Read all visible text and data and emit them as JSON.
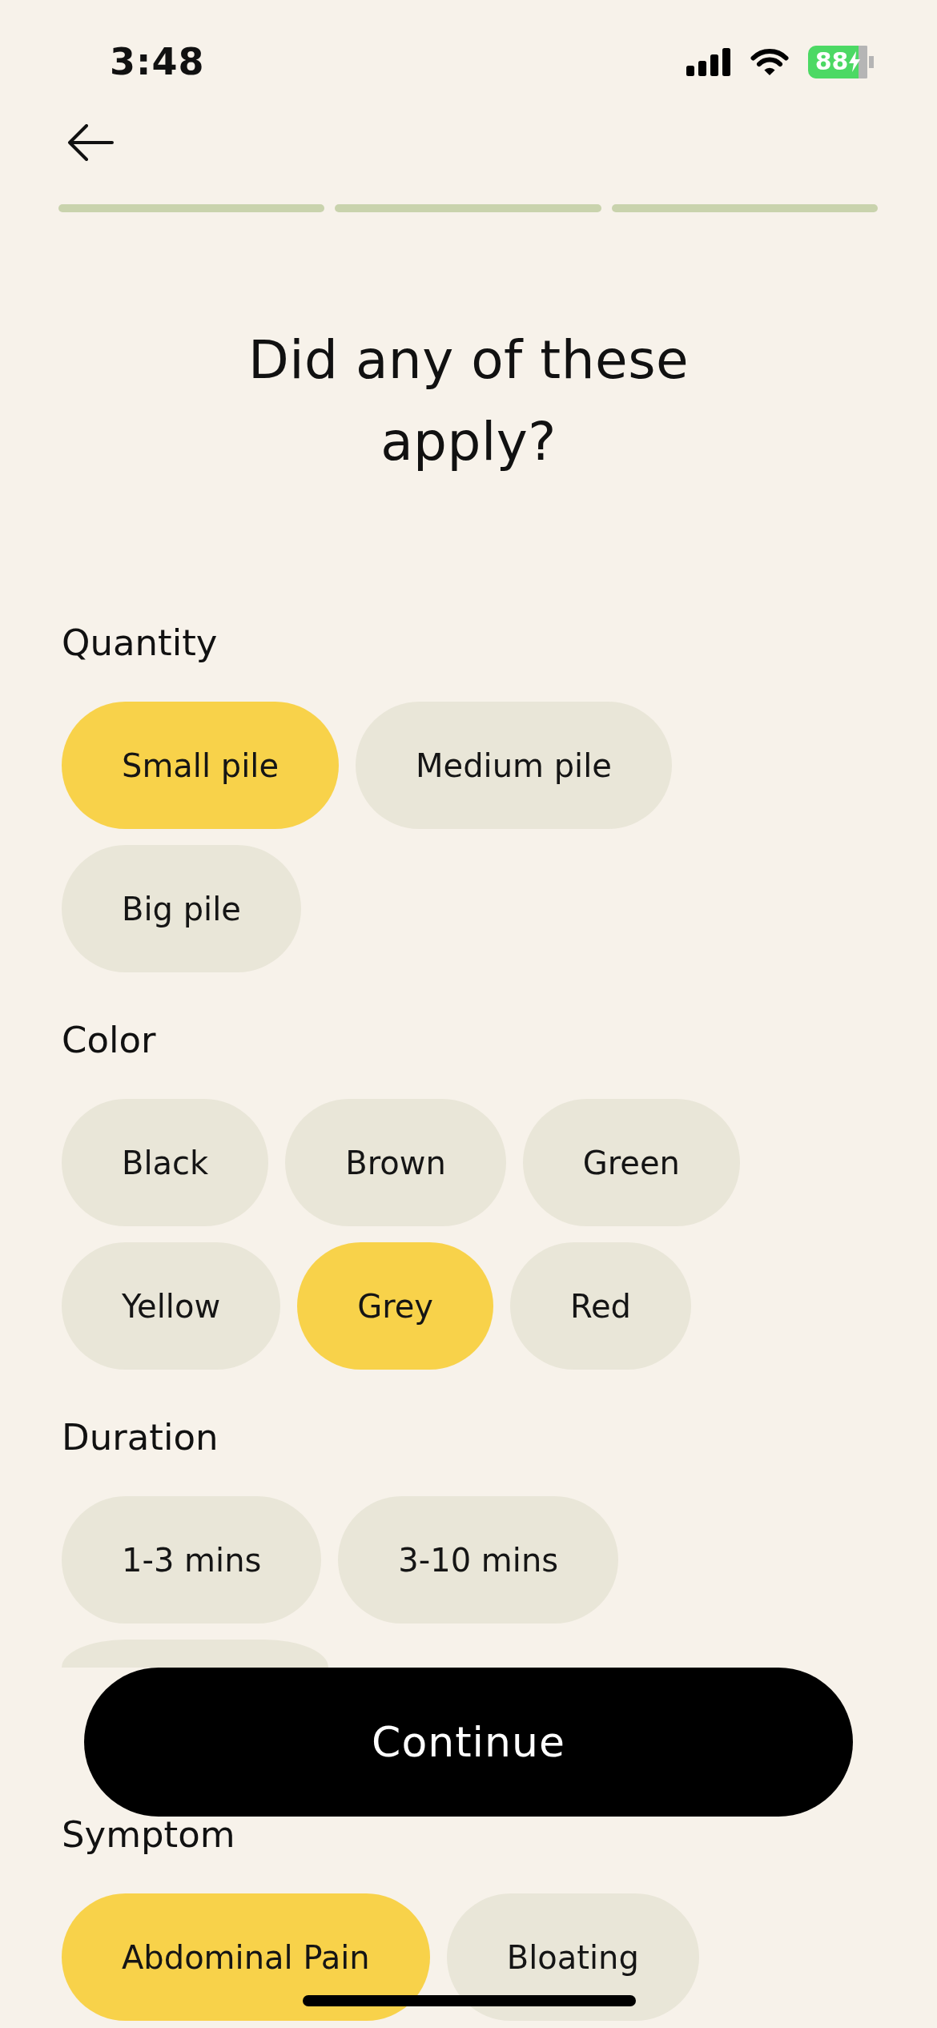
{
  "status_bar": {
    "time": "3:48",
    "battery": "88"
  },
  "progress_steps": [
    {
      "done": true
    },
    {
      "done": true
    },
    {
      "done": true
    }
  ],
  "title": "Did any of these apply?",
  "sections": [
    {
      "label": "Quantity",
      "options": [
        {
          "label": "Small pile",
          "selected": true
        },
        {
          "label": "Medium pile",
          "selected": false
        },
        {
          "label": "Big pile",
          "selected": false
        }
      ]
    },
    {
      "label": "Color",
      "options": [
        {
          "label": "Black",
          "selected": false
        },
        {
          "label": "Brown",
          "selected": false
        },
        {
          "label": "Green",
          "selected": false
        },
        {
          "label": "Yellow",
          "selected": false
        },
        {
          "label": "Grey",
          "selected": true
        },
        {
          "label": "Red",
          "selected": false
        }
      ]
    },
    {
      "label": "Duration",
      "options": [
        {
          "label": "1-3 mins",
          "selected": false
        },
        {
          "label": "3-10 mins",
          "selected": false
        },
        {
          "selected": false
        }
      ]
    },
    {
      "label": "Symptom",
      "options": [
        {
          "label": "Abdominal Pain",
          "selected": true
        },
        {
          "label": "Bloating",
          "selected": false
        }
      ]
    }
  ],
  "continue_button": {
    "label": "Continue"
  }
}
